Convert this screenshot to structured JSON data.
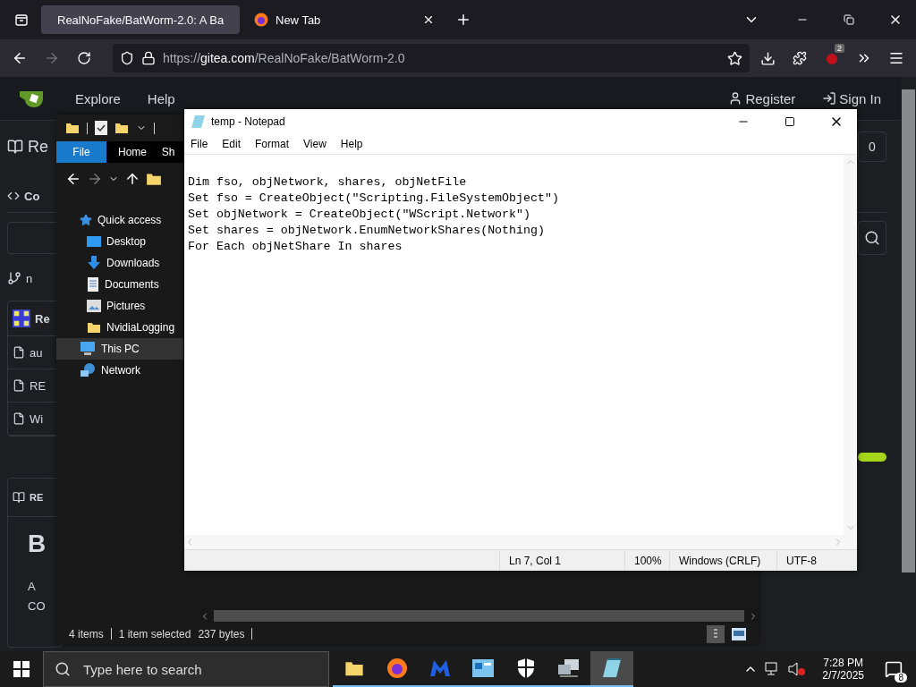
{
  "browser": {
    "tabs": [
      {
        "title": "RealNoFake/BatWorm-2.0: A Ba",
        "selected": true,
        "kind": "gitea"
      },
      {
        "title": "New Tab",
        "selected": false,
        "kind": "firefox"
      }
    ],
    "url_scheme": "https://",
    "url_host": "gitea.com",
    "url_path": "/RealNoFake/BatWorm-2.0",
    "extension_badge": "2"
  },
  "gitea": {
    "nav": [
      "Explore",
      "Help"
    ],
    "register": "Register",
    "sign_in": "Sign In",
    "repo_title": "Re",
    "tab": "Co",
    "watch_count": "0",
    "branch": "n",
    "file_header": "Re",
    "files": [
      "au",
      "RE",
      "Wi"
    ],
    "readme_tab": "RE",
    "readme_heading": "B",
    "readme_lines": [
      "A",
      "CO"
    ]
  },
  "explorer": {
    "ribbon_tabs": [
      {
        "label": "File",
        "selected": true
      },
      {
        "label": "Home",
        "selected": false
      },
      {
        "label": "Sh",
        "selected": false
      }
    ],
    "nav": [
      {
        "label": "Quick access",
        "kind": "star",
        "selected": false,
        "children": [
          {
            "label": "Desktop",
            "kind": "desktop",
            "selected": false
          },
          {
            "label": "Downloads",
            "kind": "downloads",
            "selected": false
          },
          {
            "label": "Documents",
            "kind": "documents",
            "selected": false
          },
          {
            "label": "Pictures",
            "kind": "pictures",
            "selected": false
          },
          {
            "label": "NvidiaLogging",
            "kind": "folder",
            "selected": false
          }
        ]
      },
      {
        "label": "This PC",
        "kind": "pc",
        "selected": true
      },
      {
        "label": "Network",
        "kind": "network",
        "selected": false
      }
    ],
    "status": {
      "items": "4 items",
      "selected": "1 item selected",
      "size": "237 bytes"
    }
  },
  "notepad": {
    "title": "temp - Notepad",
    "menu": [
      "File",
      "Edit",
      "Format",
      "View",
      "Help"
    ],
    "lines": [
      "Dim fso, objNetwork, shares, objNetFile",
      "Set fso = CreateObject(\"Scripting.FileSystemObject\")",
      "Set objNetwork = CreateObject(\"WScript.Network\")",
      "Set shares = objNetwork.EnumNetworkShares(Nothing)",
      "For Each objNetShare In shares"
    ],
    "status": {
      "position": "Ln 7, Col 1",
      "zoom": "100%",
      "line_endings": "Windows (CRLF)",
      "encoding": "UTF-8"
    }
  },
  "taskbar": {
    "search_placeholder": "Type here to search",
    "apps": [
      {
        "kind": "folder",
        "running": true,
        "active": false
      },
      {
        "kind": "firefox",
        "running": true,
        "active": false
      },
      {
        "kind": "claw",
        "running": true,
        "active": false
      },
      {
        "kind": "panel",
        "running": true,
        "active": false
      },
      {
        "kind": "shield",
        "running": true,
        "active": false
      },
      {
        "kind": "computers",
        "running": true,
        "active": false
      },
      {
        "kind": "notepad",
        "running": true,
        "active": true
      }
    ],
    "time": "7:28 PM",
    "date": "2/7/2025",
    "notifications": "8"
  }
}
